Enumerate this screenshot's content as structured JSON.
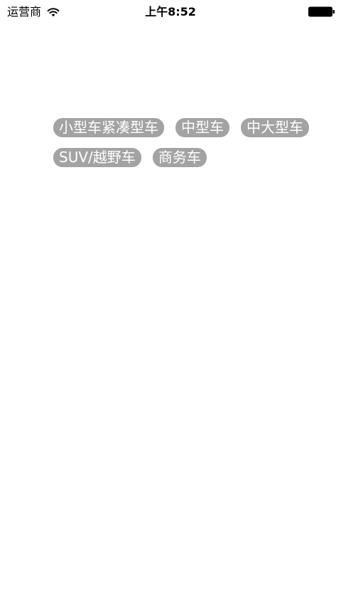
{
  "status_bar": {
    "carrier": "运营商",
    "time": "上午8:52",
    "icons": [
      "wifi-icon",
      "battery-icon"
    ]
  },
  "tags": {
    "row1": [
      "小型车紧凑型车",
      "中型车",
      "中大型车"
    ],
    "row2": [
      "SUV/越野车",
      "商务车"
    ]
  },
  "colors": {
    "tag_background": "#a3a3a3",
    "tag_text": "#ffffff",
    "background": "#ffffff"
  }
}
